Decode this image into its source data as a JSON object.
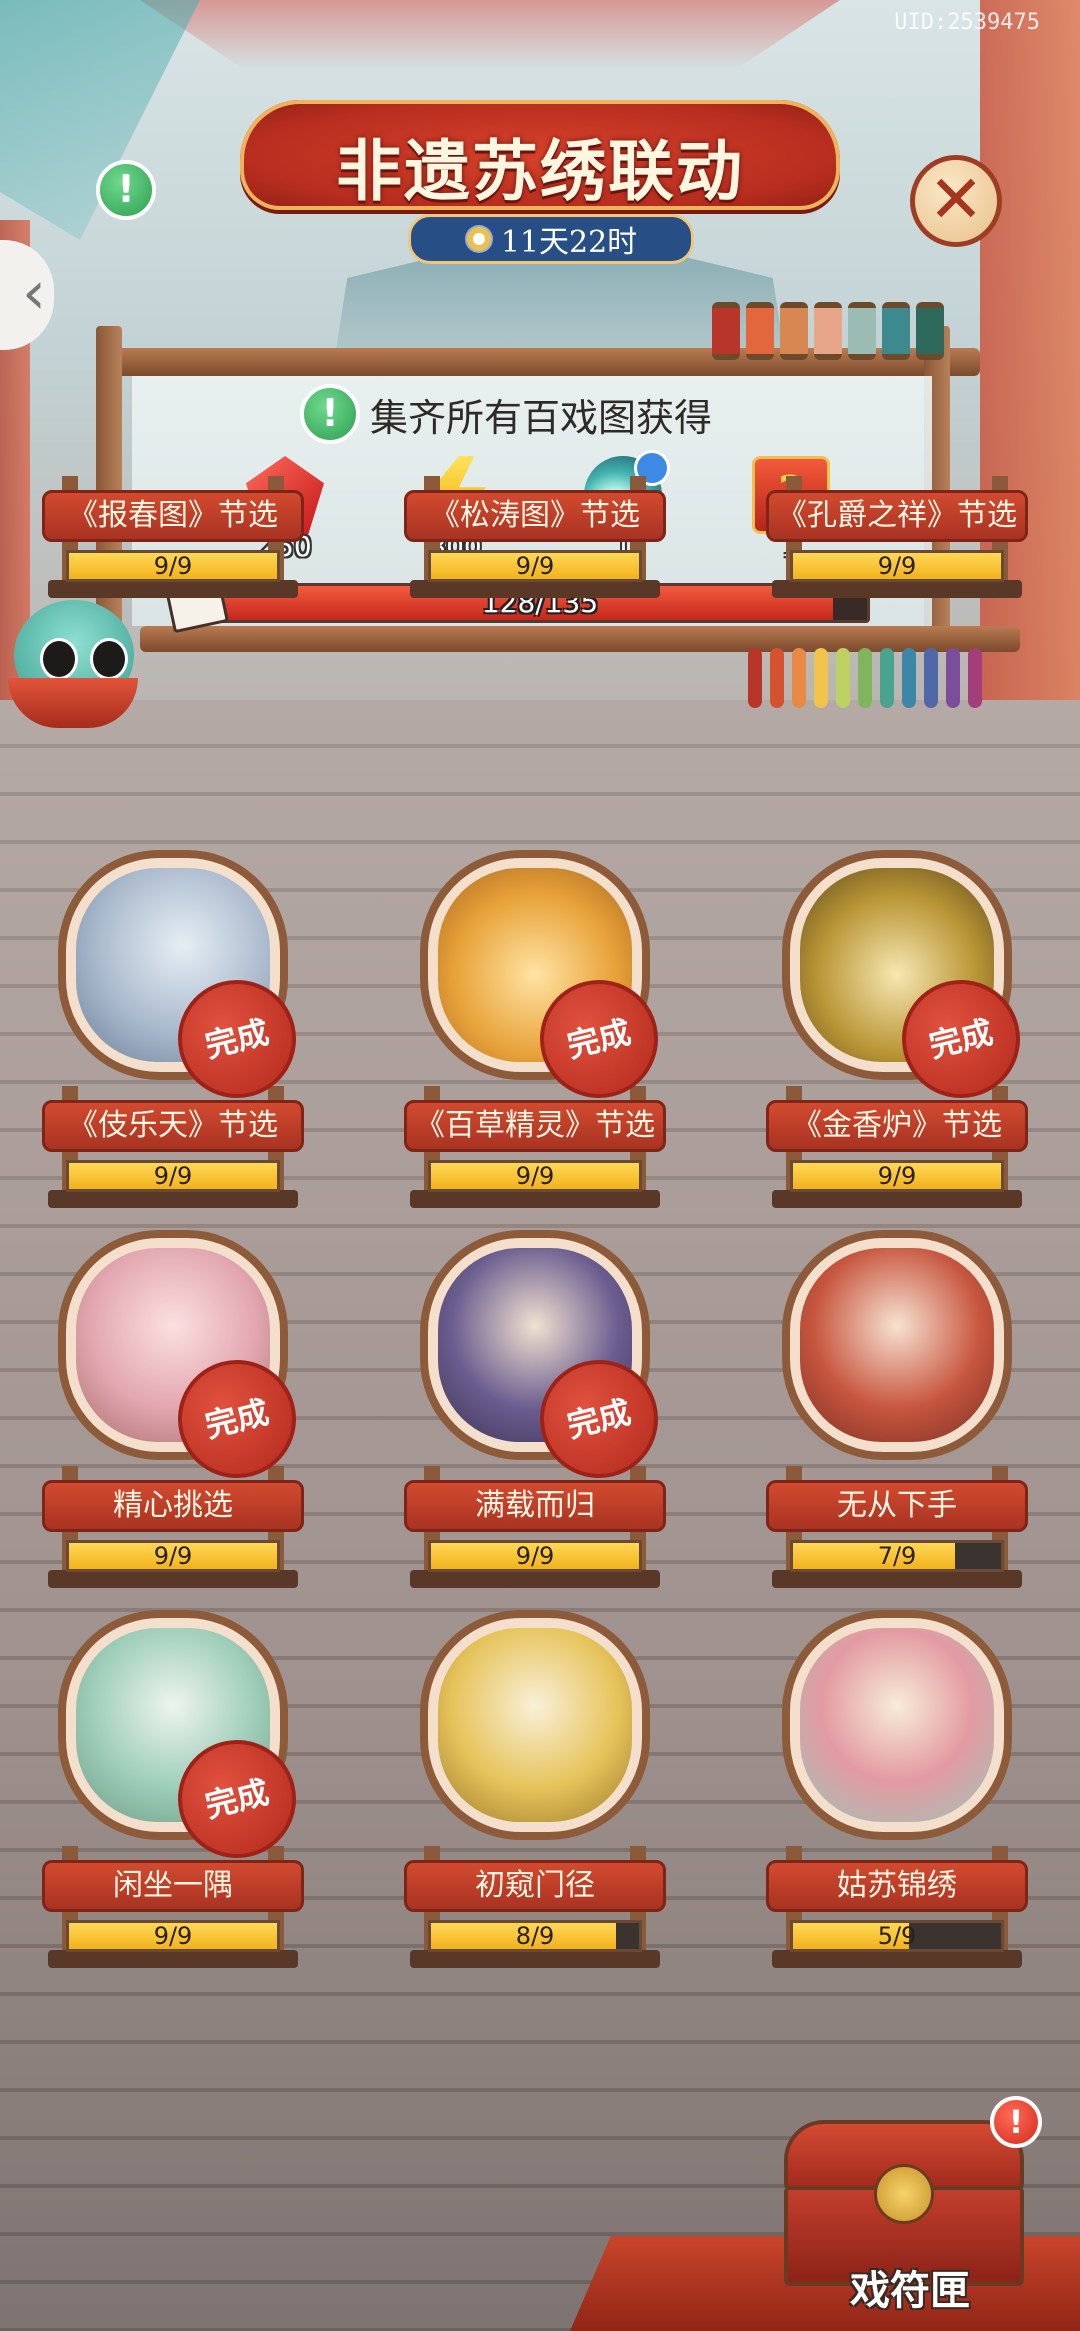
{
  "uid": "UID:2539475",
  "header": {
    "title": "非遗苏绣联动",
    "timer": "11天22时"
  },
  "rewards_panel": {
    "label": "集齐所有百戏图获得",
    "items": [
      {
        "icon": "red-gem-icon",
        "count": "250"
      },
      {
        "icon": "lightning-icon",
        "count": "800"
      },
      {
        "icon": "jade-gourd-icon",
        "count": "1"
      },
      {
        "icon": "mystery-box-icon",
        "count": "1"
      }
    ],
    "progress": {
      "text": "128/135",
      "current": 128,
      "total": 135
    }
  },
  "albums": [
    {
      "name": "《报春图》节选",
      "count": "9/9",
      "current": 9,
      "total": 9,
      "done": false,
      "done_label": ""
    },
    {
      "name": "《松涛图》节选",
      "count": "9/9",
      "current": 9,
      "total": 9,
      "done": false,
      "done_label": ""
    },
    {
      "name": "《孔爵之祥》节选",
      "count": "9/9",
      "current": 9,
      "total": 9,
      "done": false,
      "done_label": ""
    },
    {
      "name": "《伎乐天》节选",
      "count": "9/9",
      "current": 9,
      "total": 9,
      "done": true,
      "done_label": "完成"
    },
    {
      "name": "《百草精灵》节选",
      "count": "9/9",
      "current": 9,
      "total": 9,
      "done": true,
      "done_label": "完成"
    },
    {
      "name": "《金香炉》节选",
      "count": "9/9",
      "current": 9,
      "total": 9,
      "done": true,
      "done_label": "完成"
    },
    {
      "name": "精心挑选",
      "count": "9/9",
      "current": 9,
      "total": 9,
      "done": true,
      "done_label": "完成"
    },
    {
      "name": "满载而归",
      "count": "9/9",
      "current": 9,
      "total": 9,
      "done": true,
      "done_label": "完成"
    },
    {
      "name": "无从下手",
      "count": "7/9",
      "current": 7,
      "total": 9,
      "done": false,
      "done_label": ""
    },
    {
      "name": "闲坐一隅",
      "count": "9/9",
      "current": 9,
      "total": 9,
      "done": true,
      "done_label": "完成"
    },
    {
      "name": "初窥门径",
      "count": "8/9",
      "current": 8,
      "total": 9,
      "done": false,
      "done_label": ""
    },
    {
      "name": "姑苏锦绣",
      "count": "5/9",
      "current": 5,
      "total": 9,
      "done": false,
      "done_label": ""
    }
  ],
  "chest": {
    "label": "戏符匣",
    "alert": "!"
  },
  "colors": {
    "accent_red": "#c4281d",
    "gold": "#f2b21c",
    "teal": "#3b9f93"
  }
}
